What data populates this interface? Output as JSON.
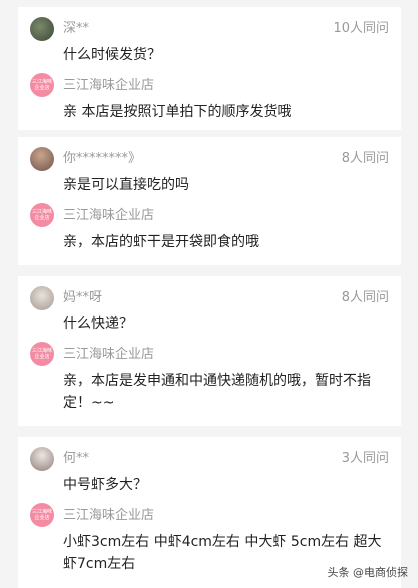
{
  "qa_items": [
    {
      "asker": "深**",
      "same_ask": "10人同问",
      "question": "什么时候发货？",
      "shop": "三江海味企业店",
      "answer": "亲 本店是按照订单拍下的顺序发货哦",
      "avatar_color": "#55604a"
    },
    {
      "asker": "你********》",
      "same_ask": "8人同问",
      "question": "亲是可以直接吃的吗",
      "shop": "三江海味企业店",
      "answer": "亲，本店的虾干是开袋即食的哦",
      "avatar_color": "#8a6a5a"
    },
    {
      "asker": "妈**呀",
      "same_ask": "8人同问",
      "question": "什么快递？",
      "shop": "三江海味企业店",
      "answer": "亲，本店是发申通和中通快递随机的哦，暂时不指定！~~",
      "avatar_color": "#c9c2b8"
    },
    {
      "asker": "何**",
      "same_ask": "3人同问",
      "question": "中号虾多大？",
      "shop": "三江海味企业店",
      "answer": "小虾3cm左右 中虾4cm左右 中大虾 5cm左右 超大虾7cm左右",
      "avatar_color": "#b8a9a4"
    }
  ],
  "shop_avatar_text": "三江海味企业店",
  "shop_avatar_color": "#f48ba3",
  "watermark": "头条 @电商侦探"
}
